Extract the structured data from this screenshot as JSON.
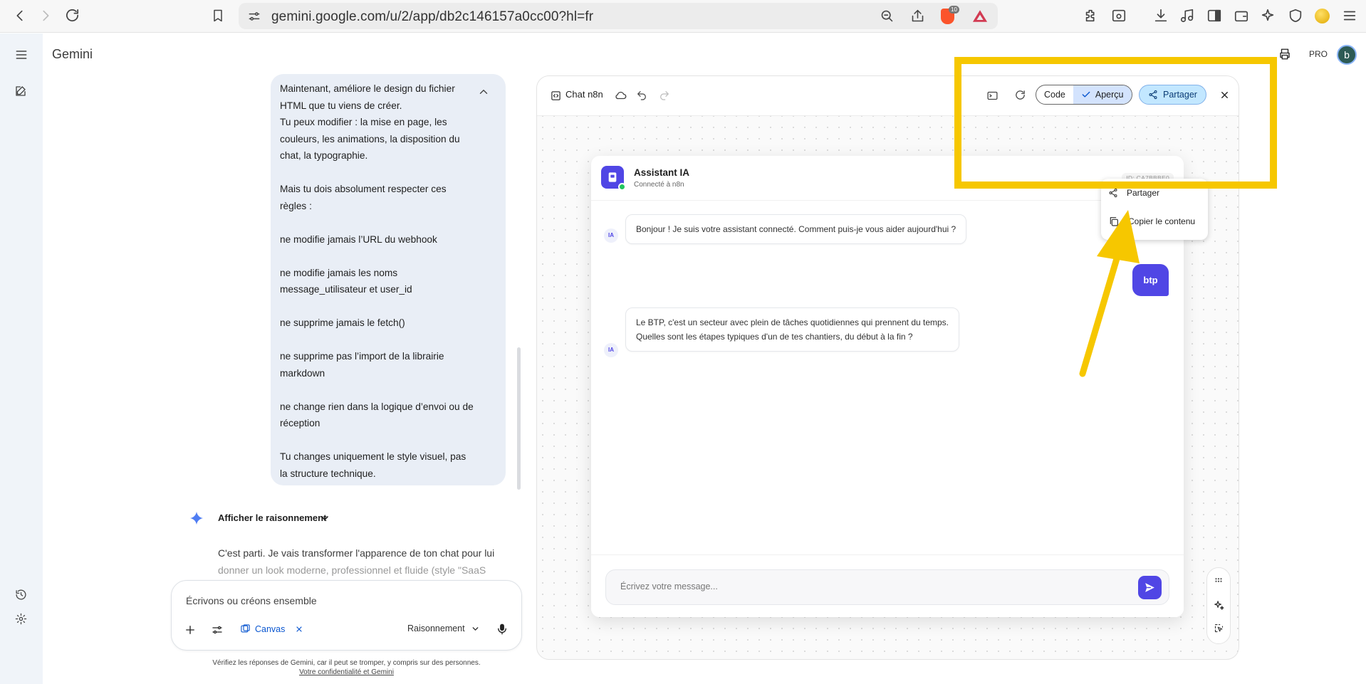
{
  "browser": {
    "url": "gemini.google.com/u/2/app/db2c146157a0cc00?hl=fr",
    "brave_badge": "10"
  },
  "app": {
    "name": "Gemini",
    "plan_badge": "PRO",
    "account_initial": "b"
  },
  "conversation": {
    "user_message": "Maintenant, améliore le design du fichier\nHTML que tu viens de créer.\nTu peux modifier : la mise en page, les\ncouleurs, les animations, la disposition du\nchat, la typographie.\n\nMais tu dois absolument respecter ces\nrègles :\n\nne modifie jamais l’URL du webhook\n\nne modifie jamais les noms\nmessage_utilisateur et user_id\n\nne supprime jamais le fetch()\n\nne supprime pas l’import de la librairie\nmarkdown\n\nne change rien dans la logique d’envoi ou de\nréception\n\nTu changes uniquement le style visuel, pas\nla structure technique.",
    "reasoning_label": "Afficher le raisonnement",
    "reply_line1": "C'est parti. Je vais transformer l'apparence de ton chat pour lui",
    "reply_line2": "donner un look moderne, professionnel et fluide (style \"SaaS"
  },
  "prompt": {
    "placeholder": "Écrivons ou créons ensemble",
    "canvas_chip": "Canvas",
    "mode_label": "Raisonnement",
    "disclaimer": "Vérifiez les réponses de Gemini, car il peut se tromper, y compris sur des personnes.",
    "privacy_link": "Votre confidentialité et Gemini"
  },
  "canvas": {
    "title": "Chat n8n",
    "code_label": "Code",
    "preview_label": "Aperçu",
    "share_label": "Partager",
    "share_menu": {
      "share": "Partager",
      "copy": "Copier le contenu"
    }
  },
  "chat_app": {
    "bot_name": "Assistant IA",
    "bot_status": "Connecté à n8n",
    "session_id": "ID: CA7BBBE0",
    "ia_tag": "IA",
    "greeting": "Bonjour ! Je suis votre assistant connecté. Comment puis-je vous aider aujourd'hui ?",
    "user_reply": "btp",
    "bot_reply_line1": "Le BTP, c'est un secteur avec plein de tâches quotidiennes qui prennent du temps.",
    "bot_reply_line2": "Quelles sont les étapes typiques d'un de tes chantiers, du début à la fin ?",
    "input_placeholder": "Écrivez votre message..."
  },
  "colors": {
    "accent": "#5046e5",
    "highlight": "#f6c700",
    "share_button": "#c2e7ff",
    "user_bubble": "#e9eef6"
  }
}
